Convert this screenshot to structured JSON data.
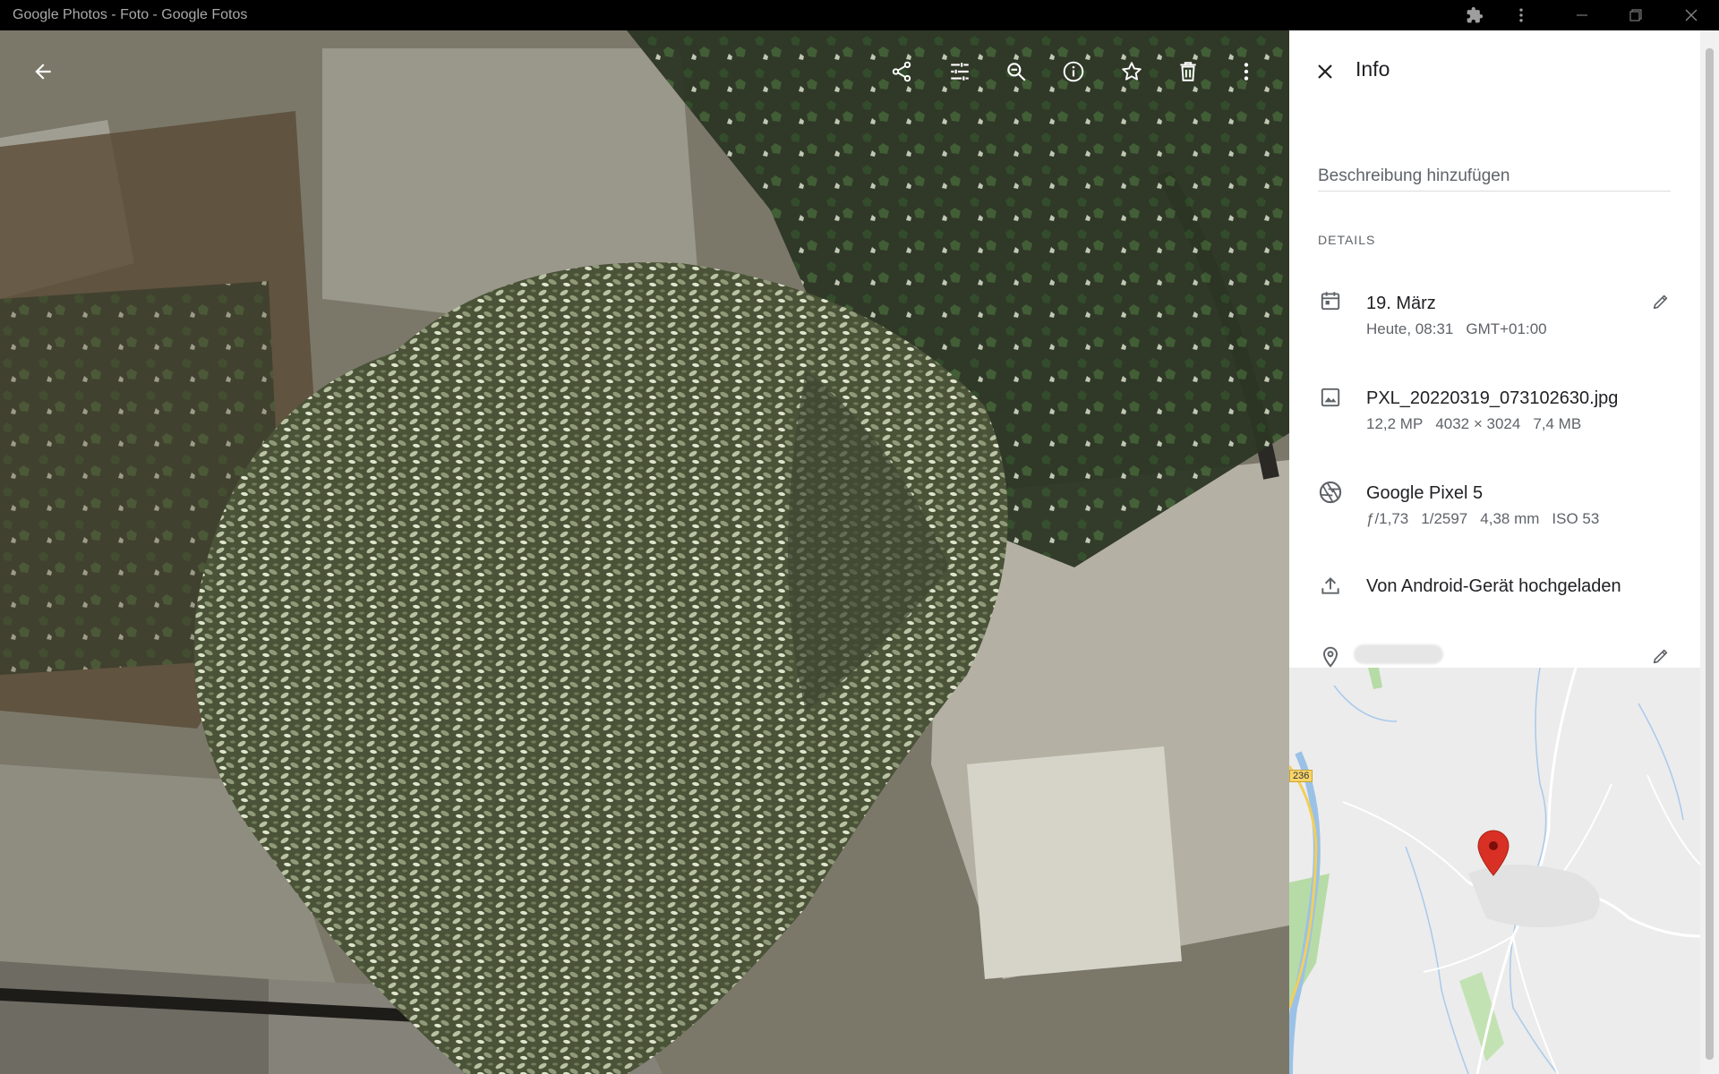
{
  "window": {
    "title": "Google Photos - Foto - Google Fotos",
    "controls": [
      "extensions-icon",
      "menu-dots-icon",
      "minimize-icon",
      "restore-icon",
      "close-icon"
    ]
  },
  "toolbar": {
    "icons": [
      "back-arrow-icon",
      "share-icon",
      "edit-tune-icon",
      "zoom-icon",
      "info-icon",
      "star-icon",
      "trash-icon",
      "more-vert-icon"
    ]
  },
  "info": {
    "title": "Info",
    "description_placeholder": "Beschreibung hinzufügen",
    "details_label": "DETAILS",
    "date": {
      "primary": "19. März",
      "time": "Heute, 08:31",
      "timezone": "GMT+01:00"
    },
    "file": {
      "name": "PXL_20220319_073102630.jpg",
      "megapixels": "12,2 MP",
      "resolution": "4032 × 3024",
      "size": "7,4 MB"
    },
    "camera": {
      "model": "Google Pixel 5",
      "aperture": "ƒ/1,73",
      "shutter": "1/2597",
      "focal_length": "4,38 mm",
      "iso": "ISO 53"
    },
    "upload": {
      "text": "Von Android-Gerät hochgeladen"
    },
    "map": {
      "road_label": "236"
    }
  },
  "colors": {
    "accent_pin": "#d93025",
    "panel_bg": "#ffffff",
    "titlebar_bg": "#000000"
  }
}
